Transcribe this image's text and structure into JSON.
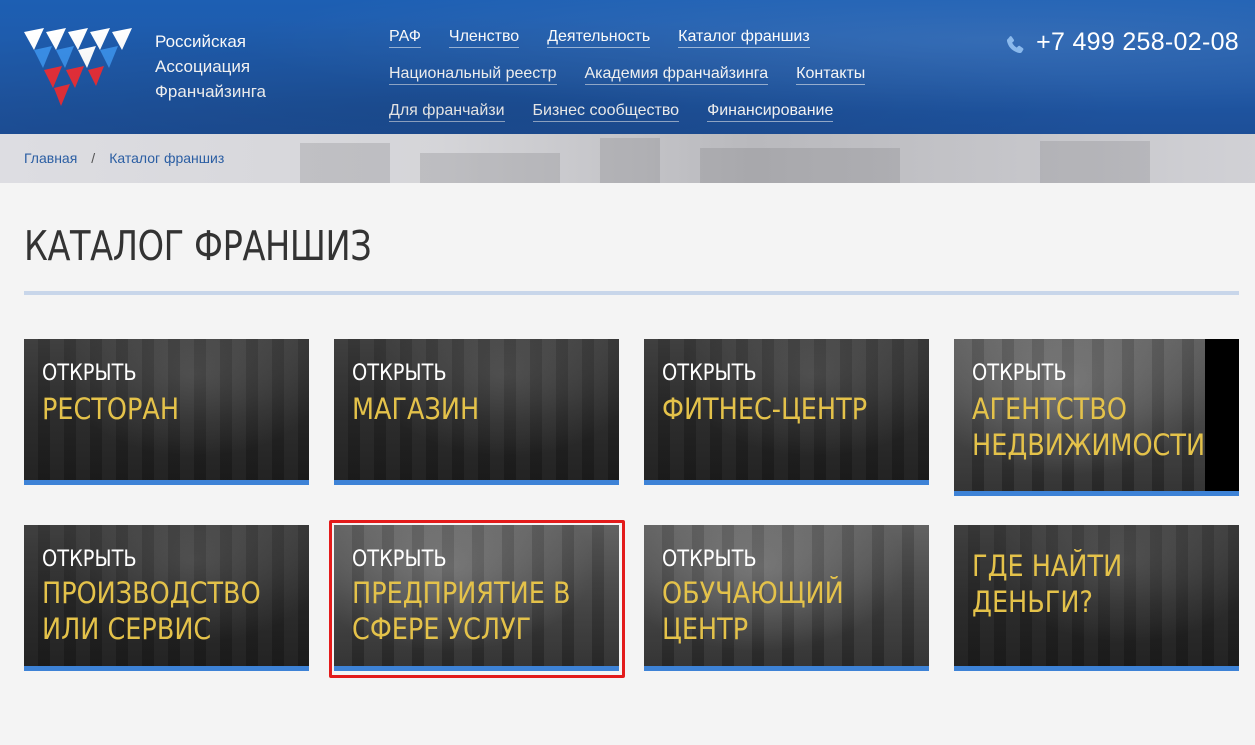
{
  "header": {
    "logo_lines": [
      "Российская",
      "Ассоциация",
      "Франчайзинга"
    ],
    "nav_rows": [
      [
        "РАФ",
        "Членство",
        "Деятельность",
        "Каталог франшиз"
      ],
      [
        "Национальный реестр",
        "Академия франчайзинга",
        "Контакты"
      ],
      [
        "Для франчайзи",
        "Бизнес сообщество",
        "Финансирование"
      ]
    ],
    "phone": "+7 499 258-02-08"
  },
  "breadcrumb": {
    "home": "Главная",
    "separator": "/",
    "current": "Каталог франшиз"
  },
  "page_title": "КАТАЛОГ ФРАНШИЗ",
  "tiles": [
    {
      "top": "ОТКРЫТЬ",
      "lines": [
        "РЕСТОРАН"
      ]
    },
    {
      "top": "ОТКРЫТЬ",
      "lines": [
        "МАГАЗИН"
      ]
    },
    {
      "top": "ОТКРЫТЬ",
      "lines": [
        "ФИТНЕС-ЦЕНТР"
      ]
    },
    {
      "top": "ОТКРЫТЬ",
      "lines": [
        "АГЕНТСТВО",
        "НЕДВИЖИМОСТИ"
      ]
    },
    {
      "top": "ОТКРЫТЬ",
      "lines": [
        "ПРОИЗВОДСТВО",
        "ИЛИ СЕРВИС"
      ]
    },
    {
      "top": "ОТКРЫТЬ",
      "lines": [
        "ПРЕДПРИЯТИЕ В",
        "СФЕРЕ УСЛУГ"
      ]
    },
    {
      "top": "ОТКРЫТЬ",
      "lines": [
        "ОБУЧАЮЩИЙ",
        "ЦЕНТР"
      ]
    },
    {
      "top": "",
      "lines": [
        "ГДЕ НАЙТИ",
        "ДЕНЬГИ?"
      ]
    }
  ],
  "colors": {
    "header_blue": "#1f58a6",
    "tile_accent": "#3d82d6",
    "tile_gold": "#e4c24a",
    "highlight_red": "#e31b1b"
  }
}
